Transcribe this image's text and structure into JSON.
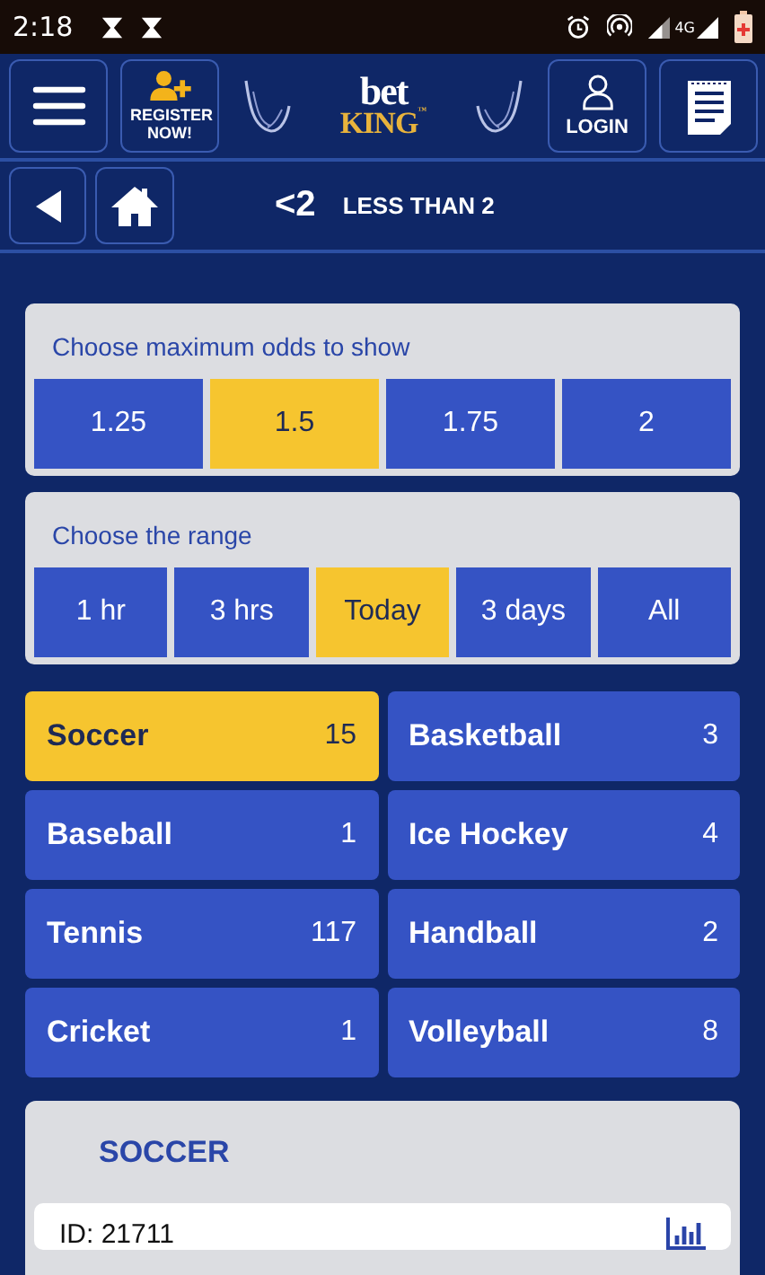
{
  "status_bar": {
    "time": "2:18",
    "network": "4G"
  },
  "header": {
    "register_label": "REGISTER NOW!",
    "logo": {
      "top": "bet",
      "bottom": "KING",
      "mark": "™"
    },
    "login_label": "LOGIN"
  },
  "nav": {
    "symbol": "<2",
    "title": "LESS THAN 2"
  },
  "odds_filter": {
    "title": "Choose maximum odds to show",
    "options": [
      {
        "label": "1.25",
        "selected": false
      },
      {
        "label": "1.5",
        "selected": true
      },
      {
        "label": "1.75",
        "selected": false
      },
      {
        "label": "2",
        "selected": false
      }
    ]
  },
  "range_filter": {
    "title": "Choose the range",
    "options": [
      {
        "label": "1 hr",
        "selected": false
      },
      {
        "label": "3 hrs",
        "selected": false
      },
      {
        "label": "Today",
        "selected": true
      },
      {
        "label": "3 days",
        "selected": false
      },
      {
        "label": "All",
        "selected": false
      }
    ]
  },
  "sports": [
    {
      "name": "Soccer",
      "count": "15",
      "selected": true
    },
    {
      "name": "Basketball",
      "count": "3",
      "selected": false
    },
    {
      "name": "Baseball",
      "count": "1",
      "selected": false
    },
    {
      "name": "Ice Hockey",
      "count": "4",
      "selected": false
    },
    {
      "name": "Tennis",
      "count": "117",
      "selected": false
    },
    {
      "name": "Handball",
      "count": "2",
      "selected": false
    },
    {
      "name": "Cricket",
      "count": "1",
      "selected": false
    },
    {
      "name": "Volleyball",
      "count": "8",
      "selected": false
    }
  ],
  "section": {
    "title": "SOCCER",
    "events": [
      {
        "id_label": "ID: 21711"
      }
    ]
  }
}
